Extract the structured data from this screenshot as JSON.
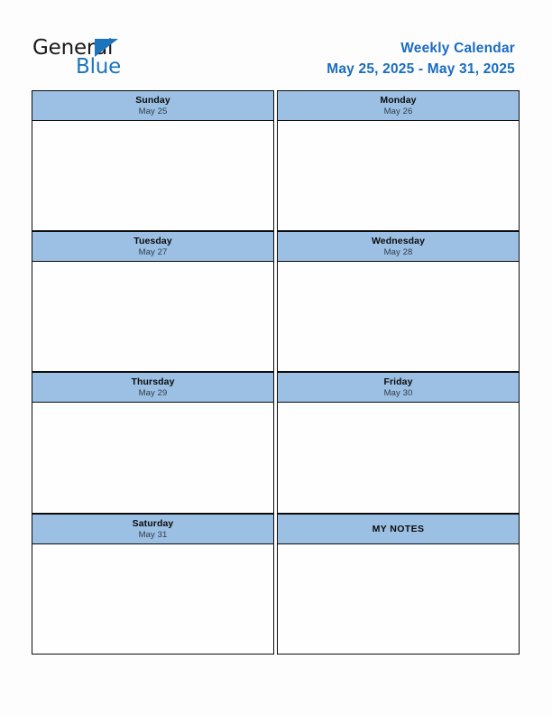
{
  "brand": {
    "name_part1": "General",
    "name_part2": "Blue",
    "triangle_icon": "triangle-icon",
    "color_dark": "#1a1a1a",
    "color_blue": "#1b74bc"
  },
  "header": {
    "title": "Weekly Calendar",
    "date_range": "May 25, 2025 - May 31, 2025",
    "title_color": "#1a6cc0"
  },
  "theme": {
    "header_cell_bg": "#9cc0e4",
    "border_color": "#0d0d0d",
    "page_bg": "#fdfdfd",
    "body_cell_bg": "#fefefe",
    "day_name_color": "#0b0b0b",
    "day_date_color": "#2e3a46"
  },
  "calendar": {
    "cells": [
      {
        "name": "Sunday",
        "date": "May 25",
        "content": "",
        "column": "left",
        "row": 0
      },
      {
        "name": "Monday",
        "date": "May 26",
        "content": "",
        "column": "right",
        "row": 0
      },
      {
        "name": "Tuesday",
        "date": "May 27",
        "content": "",
        "column": "left",
        "row": 1
      },
      {
        "name": "Wednesday",
        "date": "May 28",
        "content": "",
        "column": "right",
        "row": 1
      },
      {
        "name": "Thursday",
        "date": "May 29",
        "content": "",
        "column": "left",
        "row": 2
      },
      {
        "name": "Friday",
        "date": "May 30",
        "content": "",
        "column": "right",
        "row": 2
      },
      {
        "name": "Saturday",
        "date": "May 31",
        "content": "",
        "column": "left",
        "row": 3
      },
      {
        "name": "MY NOTES",
        "date": "",
        "content": "",
        "column": "right",
        "row": 3
      }
    ]
  }
}
